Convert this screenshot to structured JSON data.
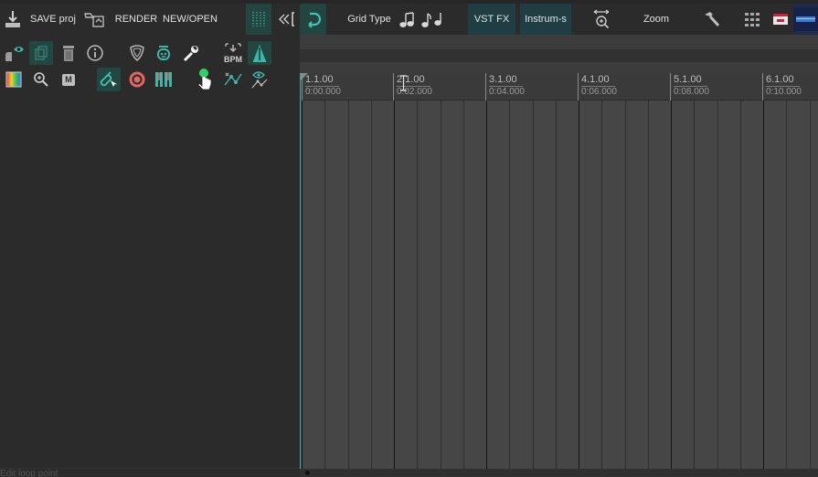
{
  "toolbar": {
    "save_label": "SAVE proj",
    "render_label": "RENDER",
    "new_open_label": "NEW/OPEN",
    "grid_type_label": "Grid Type",
    "vst_fx_label": "VST FX",
    "instruments_label": "Instrum-s",
    "zoom_label": "Zoom"
  },
  "left_panel": {
    "bpm_label": "BPM",
    "midi_badge": "M"
  },
  "ruler": {
    "markers": [
      {
        "bar": "1.1.00",
        "time": "0:00.000"
      },
      {
        "bar": "2.1.00",
        "time": "0:02.000"
      },
      {
        "bar": "3.1.00",
        "time": "0:04.000"
      },
      {
        "bar": "4.1.00",
        "time": "0:06.000"
      },
      {
        "bar": "5.1.00",
        "time": "0:08.000"
      },
      {
        "bar": "6.1.00",
        "time": "0:10.000"
      }
    ]
  },
  "status": {
    "hint_text": "Edit loop point"
  },
  "colors": {
    "accent": "#38a9a0",
    "toolbar_bg": "#2b2b2b",
    "arrange_bg": "#464646",
    "highlight": "#23443f"
  },
  "icons": {
    "save": "download-tray-icon",
    "render": "render-icon",
    "grid": "grid-lines-icon",
    "rewind": "skip-to-start-icon",
    "loop": "loop-icon",
    "notes": "music-notes-icon",
    "zoom": "zoom-fit-icon",
    "hammer": "hammer-icon",
    "dots": "dot-grid-icon",
    "window": "window-icon"
  }
}
